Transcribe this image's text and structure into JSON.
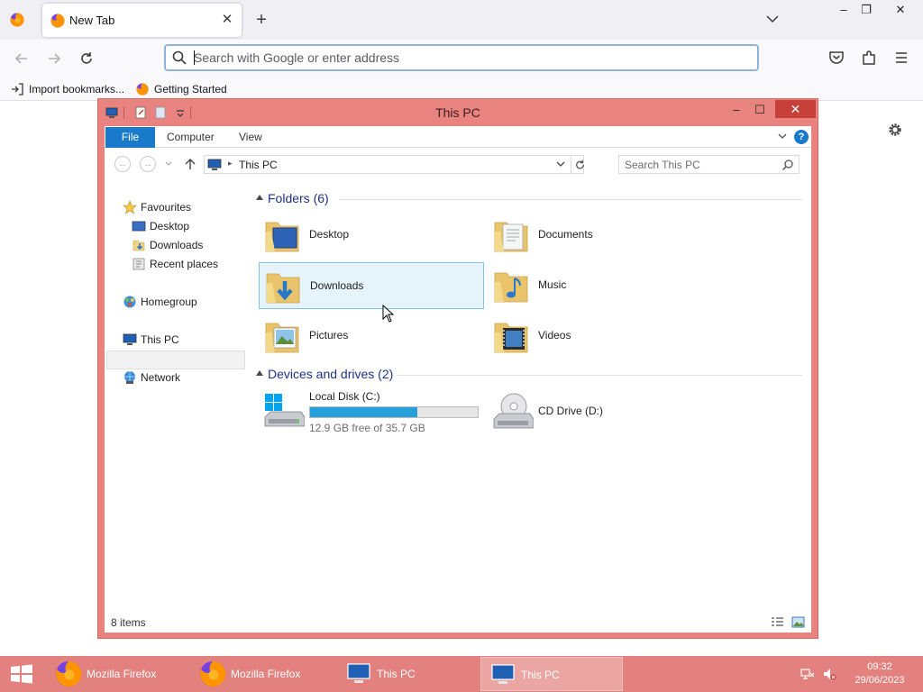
{
  "browser": {
    "tab_title": "New Tab",
    "url_placeholder": "Search with Google or enter address",
    "bookmarks": [
      {
        "label": "Import bookmarks...",
        "icon": "import-icon"
      },
      {
        "label": "Getting Started",
        "icon": "firefox-icon"
      }
    ]
  },
  "explorer": {
    "title": "This PC",
    "ribbon_tabs": [
      "File",
      "Computer",
      "View"
    ],
    "address_crumb": "This PC",
    "search_placeholder": "Search This PC",
    "nav": {
      "favourites": "Favourites",
      "desktop": "Desktop",
      "downloads": "Downloads",
      "recent_places": "Recent places",
      "homegroup": "Homegroup",
      "this_pc": "This PC",
      "network": "Network"
    },
    "folders_header": "Folders (6)",
    "folders": [
      {
        "name": "Desktop",
        "icon": "desktop-folder-icon"
      },
      {
        "name": "Documents",
        "icon": "documents-folder-icon"
      },
      {
        "name": "Downloads",
        "icon": "downloads-folder-icon",
        "selected": true
      },
      {
        "name": "Music",
        "icon": "music-folder-icon"
      },
      {
        "name": "Pictures",
        "icon": "pictures-folder-icon"
      },
      {
        "name": "Videos",
        "icon": "videos-folder-icon"
      }
    ],
    "drives_header": "Devices and drives (2)",
    "drives": [
      {
        "name": "Local Disk (C:)",
        "free_text": "12.9 GB free of 35.7 GB",
        "used_fraction": 0.639
      },
      {
        "name": "CD Drive (D:)"
      }
    ],
    "status": "8 items"
  },
  "taskbar": {
    "items": [
      {
        "label": "Mozilla Firefox",
        "icon": "firefox-icon",
        "active": false
      },
      {
        "label": "Mozilla Firefox",
        "icon": "firefox-icon",
        "active": false
      },
      {
        "label": "This PC",
        "icon": "this-pc-icon",
        "active": false
      },
      {
        "label": "This PC",
        "icon": "this-pc-icon",
        "active": true
      }
    ],
    "time": "09:32",
    "date": "29/06/2023"
  },
  "colors": {
    "explorer_frame": "#e9837f",
    "taskbar": "#e2817e",
    "accent_blue": "#1979ca",
    "selection": "#e5f3fb",
    "disk_bar": "#26a0da"
  }
}
